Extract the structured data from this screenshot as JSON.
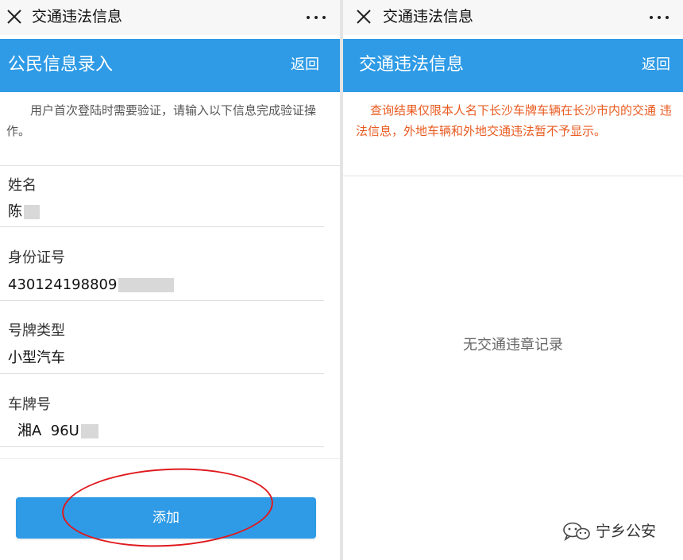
{
  "left_panel": {
    "window_title": "交通违法信息",
    "header_title": "公民信息录入",
    "back_label": "返回",
    "notice": "用户首次登陆时需要验证，请输入以下信息完成验证操作。",
    "fields": [
      {
        "label": "姓名",
        "value": "陈"
      },
      {
        "label": "身份证号",
        "value": "430124198809"
      },
      {
        "label": "号牌类型",
        "value": "小型汽车"
      },
      {
        "label": "车牌号",
        "value": "湘A  96U"
      }
    ],
    "add_button_label": "添加",
    "annotation_color": "#e0191d"
  },
  "right_panel": {
    "window_title": "交通违法信息",
    "header_title": "交通违法信息",
    "back_label": "返回",
    "notice": "查询结果仅限本人名下长沙车牌车辆在长沙市内的交通 违法信息，外地车辆和外地交通违法暂不予显示。",
    "empty_message": "无交通违章记录"
  },
  "watermark": {
    "text": "宁乡公安",
    "icon": "wechat-icon"
  },
  "colors": {
    "header_blue": "#2f9be6",
    "notice_orange": "#e85a1f",
    "wx_bar": "#f7f7f7"
  }
}
